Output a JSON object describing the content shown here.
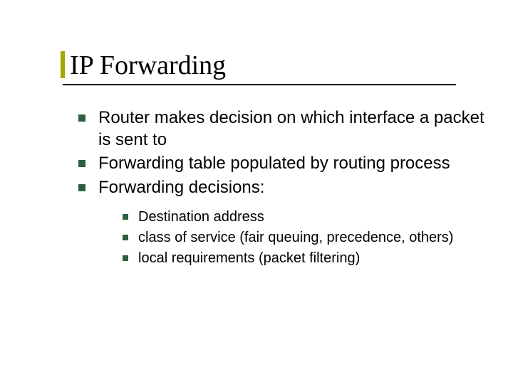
{
  "title": "IP Forwarding",
  "bullets": [
    {
      "text": "Router makes decision on which interface a packet is sent to"
    },
    {
      "text": "Forwarding table populated by routing process"
    },
    {
      "text": "Forwarding decisions:"
    }
  ],
  "sub_bullets": [
    {
      "text": "Destination address"
    },
    {
      "text": "class of service (fair queuing, precedence, others)"
    },
    {
      "text": "local requirements (packet filtering)"
    }
  ]
}
